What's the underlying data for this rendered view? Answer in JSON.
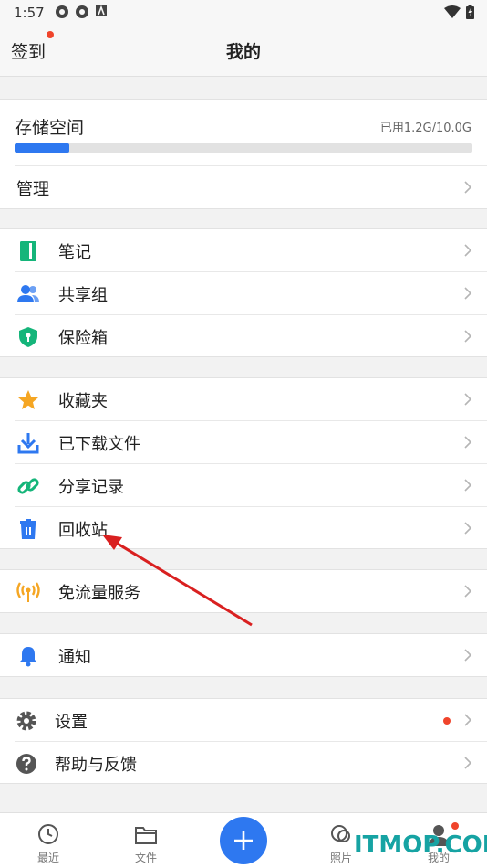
{
  "status_bar": {
    "time": "1:57"
  },
  "header": {
    "left_action": "签到",
    "title": "我的"
  },
  "storage": {
    "title": "存储空间",
    "used_text": "已用1.2G/10.0G",
    "used_fraction": 0.12,
    "manage_label": "管理"
  },
  "groups": {
    "notes": "笔记",
    "shared_group": "共享组",
    "safe_box": "保险箱",
    "favorites": "收藏夹",
    "downloaded": "已下载文件",
    "share_records": "分享记录",
    "recycle_bin": "回收站",
    "free_data": "免流量服务",
    "notifications": "通知",
    "settings": "设置",
    "help": "帮助与反馈"
  },
  "tabbar": {
    "recent": "最近",
    "files": "文件",
    "photos": "照片",
    "mine": "我的"
  },
  "watermark": "ITMOP.COM",
  "colors": {
    "accent": "#2e78f0",
    "badge": "#f0442b",
    "notes_icon": "#15b57a",
    "favorite_icon": "#f5a623",
    "free_data_icon": "#f5a623",
    "watermark": "#16a3a3",
    "annotation_arrow": "#d92020"
  }
}
